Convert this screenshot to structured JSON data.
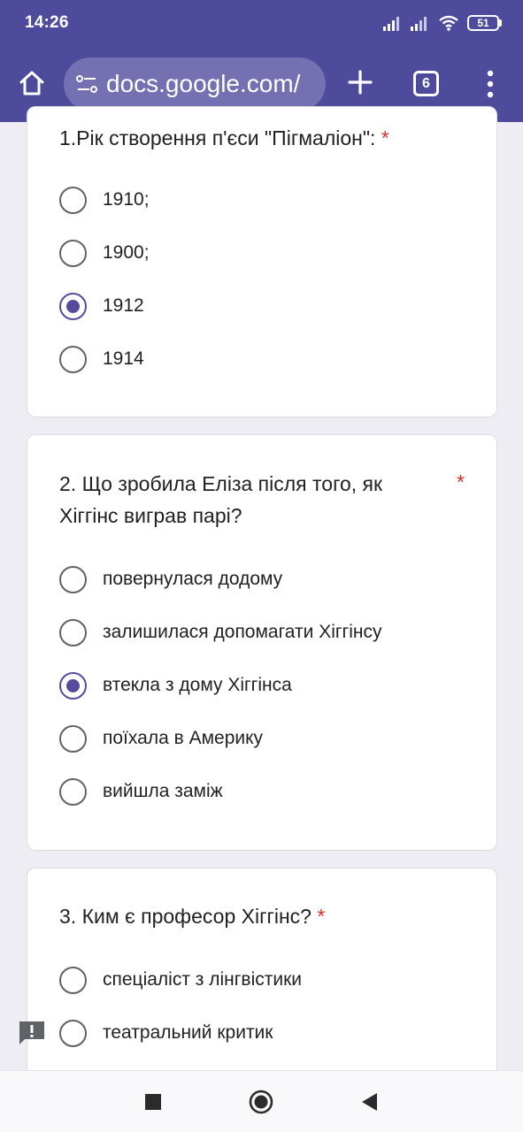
{
  "status_bar": {
    "time": "14:26",
    "battery": "51",
    "icons": [
      "signal-icon",
      "signal-icon",
      "wifi-icon",
      "battery-icon"
    ]
  },
  "browser": {
    "url": "docs.google.com/",
    "tab_count": "6",
    "icons": [
      "home-icon",
      "site-settings-icon",
      "plus-icon",
      "tab-switcher-icon",
      "more-vert-icon"
    ]
  },
  "form": {
    "questions": [
      {
        "title": "1.Рік створення п'єси \"Пігмаліон\": ",
        "required_mark": "*",
        "options": [
          "1910;",
          "1900;",
          "1912",
          "1914"
        ],
        "selected": "1912"
      },
      {
        "title": "2. Що зробила Еліза після того, як Хіггінс виграв парі?",
        "title_lines": [
          "2. Що зробила Еліза після того, як",
          "Хіггінс виграв парі?"
        ],
        "required_mark": "*",
        "options": [
          "повернулася додому",
          "залишилася допомагати Хіггінсу",
          "втекла з дому Хіггінса",
          "поїхала в Америку",
          "вийшла заміж"
        ],
        "selected": "втекла з дому Хіггінса"
      },
      {
        "title": "3. Ким є професор Хіггінс? ",
        "required_mark": "*",
        "options": [
          "спеціаліст з лінгвістики",
          "театральний критик"
        ],
        "selected": null
      }
    ]
  },
  "colors": {
    "toolbar": "#4e4a9c",
    "accent": "#5a4a9e",
    "required": "#d93025",
    "page_background": "#eeedf3"
  },
  "nav": {
    "icons": [
      "recents-square-icon",
      "home-circle-icon",
      "back-triangle-icon"
    ]
  }
}
